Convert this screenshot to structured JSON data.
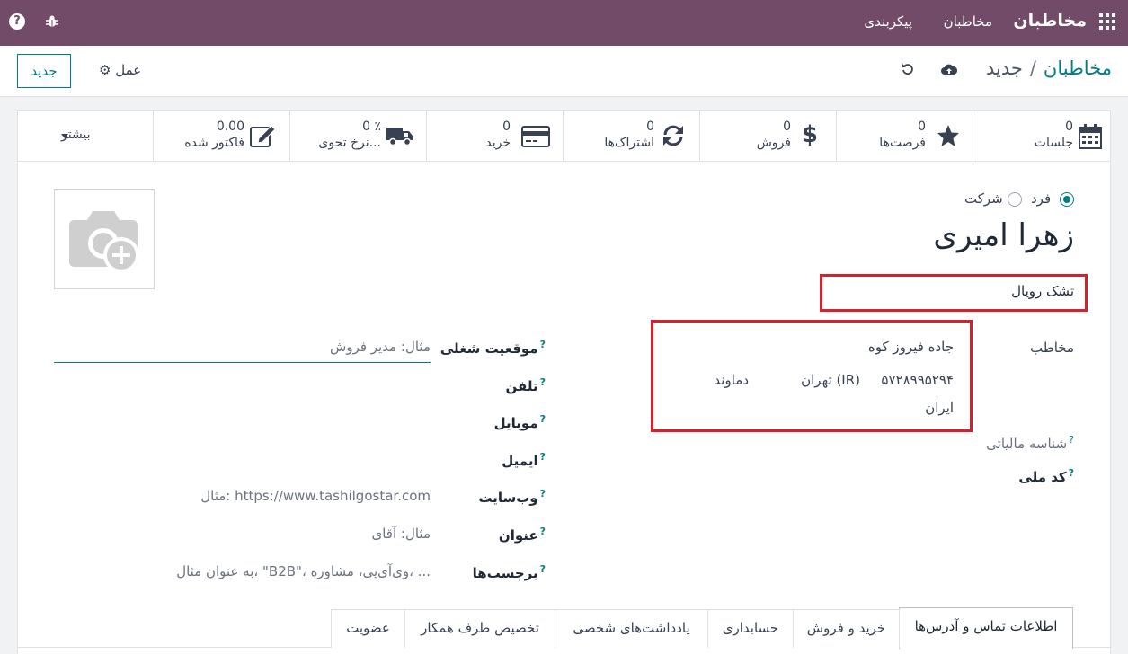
{
  "topbar": {
    "brand": "مخاطبان",
    "menu": [
      "مخاطبان",
      "پیکربندی"
    ]
  },
  "control": {
    "new_button": "جدید",
    "action_label": "عمل",
    "breadcrumb_parent": "مخاطبان",
    "breadcrumb_sep": "/",
    "breadcrumb_current": "جدید"
  },
  "smart_buttons": [
    {
      "value": "0",
      "label": "جلسات",
      "icon": "calendar-icon"
    },
    {
      "value": "0",
      "label": "فرصت‌ها",
      "icon": "star-icon"
    },
    {
      "value": "0",
      "label": "فروش",
      "icon": "dollar-icon"
    },
    {
      "value": "0",
      "label": "اشتراک‌ها",
      "icon": "refresh-icon"
    },
    {
      "value": "0",
      "label": "خرید",
      "icon": "credit-card-icon"
    },
    {
      "value": "0 ٪",
      "label": "نرخ تحوی...",
      "icon": "truck-icon"
    },
    {
      "value": "0.00",
      "label": "فاکتور شده",
      "icon": "pencil-square-icon"
    }
  ],
  "more_label": "بیشتر",
  "company_type": {
    "options": [
      "فرد",
      "شرکت"
    ],
    "selected": "فرد"
  },
  "partner_name": "زهرا امیری",
  "company_name": "تشک رویال",
  "address": {
    "label": "مخاطب",
    "street": "جاده فیروز کوه",
    "city": "دماوند",
    "state": "تهران (IR)",
    "zip": "۵۷۲۸۹۹۵۲۹۴",
    "country": "ایران"
  },
  "left_fields": {
    "tax_id_label": "شناسه مالیاتی",
    "national_code_label": "کد ملی"
  },
  "right_fields": [
    {
      "label": "موقعیت شغلی",
      "placeholder": "مثال: مدیر فروش"
    },
    {
      "label": "تلفن",
      "placeholder": ""
    },
    {
      "label": "موبایل",
      "placeholder": ""
    },
    {
      "label": "ایمیل",
      "placeholder": ""
    },
    {
      "label": "وب‌سایت",
      "placeholder": "مثال: https://www.tashilgostar.com"
    },
    {
      "label": "عنوان",
      "placeholder": "مثال: آقای"
    },
    {
      "label": "برچسب‌ها",
      "placeholder": "به عنوان مثال، \"B2B\"، وی‌آی‌پی، مشاوره، ..."
    }
  ],
  "tabs": [
    "اطلاعات تماس و آدرس‌ها",
    "خرید و فروش",
    "حسابداری",
    "یادداشت‌های شخصی",
    "تخصیص طرف همکار",
    "عضویت"
  ],
  "colors": {
    "brand": "#714b67",
    "accent": "#017e84",
    "highlight": "#d81f2a"
  }
}
